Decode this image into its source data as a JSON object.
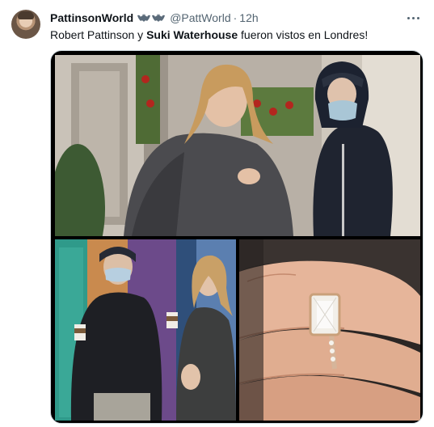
{
  "author": {
    "display_name": "PattinsonWorld",
    "handle": "@PattWorld",
    "separator": "·",
    "time": "12h"
  },
  "tweet": {
    "text_before": "Robert Pattinson y ",
    "text_bold": "Suki Waterhouse",
    "text_after": " fueron vistos en Londres!"
  },
  "icons": {
    "more": "more-horizontal-icon",
    "badge": "bat-emoji-icon"
  }
}
